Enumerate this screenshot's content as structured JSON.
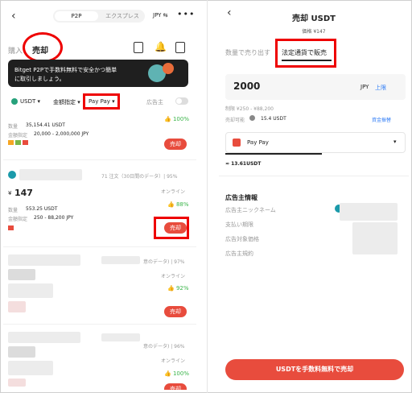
{
  "left": {
    "back_icon": "chevron-left-icon",
    "segment": {
      "p2p": "P2P",
      "express": "エクスプレス"
    },
    "currency_switch": "JPY ⇆",
    "more_icon": "more-dots-icon",
    "tabs": {
      "buy": "購入",
      "sell": "売却"
    },
    "banner": {
      "line1": "Bitget P2Pで手数料無料で安全かつ簡単",
      "line2": "に取引しましょう。"
    },
    "filters": {
      "coin": "USDT ▾",
      "amount": "金額指定 ▾",
      "payment": "Pay Pay ▾",
      "advertiser": "広告主"
    },
    "top_stub": {
      "qty_label": "数量",
      "qty_value": "35,154.41 USDT",
      "limit_label": "金額指定",
      "limit_value": "20,000 - 2,000,000 JPY",
      "rate": "100%",
      "sell": "売却"
    },
    "ad1": {
      "stats": "71 注文（30日間のデータ）| 95%",
      "price": "147",
      "currency_symbol": "¥",
      "status": "オンライン",
      "qty_label": "数量",
      "qty_value": "553.25 USDT",
      "limit_label": "金額指定",
      "limit_value": "250 - 88,200 JPY",
      "rate": "88%",
      "sell": "売却"
    },
    "ad2": {
      "stats": "意のデータ) | 97%",
      "status": "オンライン",
      "rate": "92%",
      "sell": "売却"
    },
    "ad3": {
      "stats": "意のデータ) | 96%",
      "status": "オンライン",
      "rate": "100%",
      "sell": "売却"
    }
  },
  "right": {
    "back_icon": "chevron-left-icon",
    "title": "売却 USDT",
    "price": "価格 ¥147",
    "tabs": {
      "by_qty": "数量で売り出す",
      "by_fiat": "法定通貨で販売"
    },
    "amount": "2000",
    "amount_currency": "JPY",
    "max_label": "上限",
    "limit_text": "制限 ¥250 - ¥88,200",
    "available_label": "売却可能",
    "available_value": "15.4 USDT",
    "transfer_label": "資金振替",
    "payment_method": "Pay Pay",
    "receive": "≈ 13.61USDT",
    "advertiser_section": "広告主情報",
    "info_rows": [
      "広告主ニックネーム",
      "支払い期限",
      "広告対象価格",
      "広告主規約"
    ],
    "cta": "USDTを手数料無料で売却"
  },
  "colors": {
    "accent_red": "#e84c3d",
    "green": "#3bb54a",
    "blue": "#2e7cf6",
    "banner": "#1f1f1f"
  }
}
